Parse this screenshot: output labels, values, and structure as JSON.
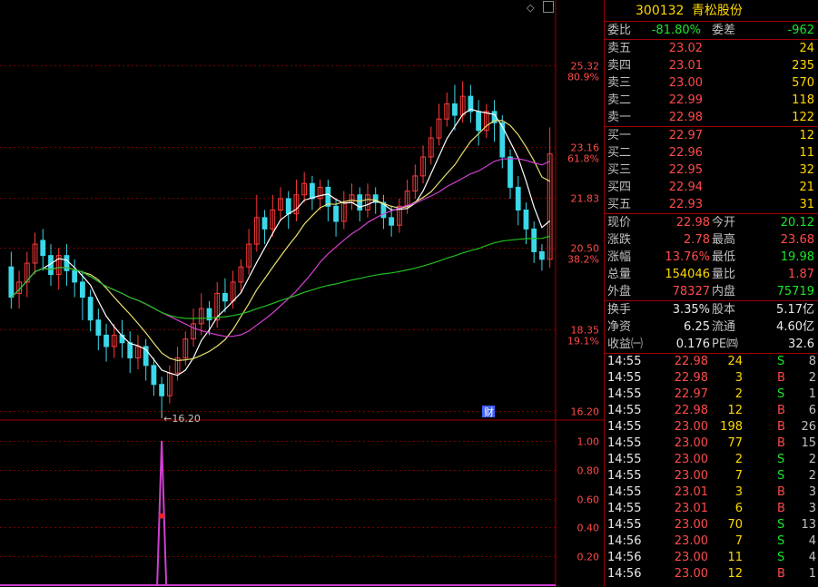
{
  "chart_data": {
    "type": "candlestick",
    "price_axis": {
      "ticks": [
        {
          "price": 25.32,
          "label": "25.32",
          "pct": "80.9%"
        },
        {
          "price": 23.16,
          "label": "23.16",
          "pct": "61.8%"
        },
        {
          "price": 21.83,
          "label": "21.83",
          "pct": ""
        },
        {
          "price": 20.5,
          "label": "20.50",
          "pct": "38.2%"
        },
        {
          "price": 18.35,
          "label": "18.35",
          "pct": "19.1%"
        },
        {
          "price": 16.2,
          "label": "16.20",
          "pct": ""
        }
      ],
      "range": [
        16.2,
        26.8
      ]
    },
    "low_marker": {
      "price": 16.2,
      "label": "16.20"
    },
    "finance_badge": "财",
    "candles": [
      [
        20.0,
        19.2,
        20.4,
        18.9
      ],
      [
        19.3,
        19.6,
        19.9,
        18.9
      ],
      [
        19.6,
        20.1,
        20.4,
        19.2
      ],
      [
        20.1,
        20.6,
        20.9,
        19.8
      ],
      [
        20.7,
        20.3,
        21.0,
        19.9
      ],
      [
        20.3,
        19.8,
        20.6,
        19.5
      ],
      [
        19.8,
        20.3,
        20.5,
        19.4
      ],
      [
        20.3,
        19.9,
        20.6,
        19.5
      ],
      [
        19.9,
        19.6,
        20.2,
        19.2
      ],
      [
        19.6,
        19.2,
        19.9,
        18.6
      ],
      [
        19.2,
        18.6,
        19.4,
        18.3
      ],
      [
        18.6,
        18.2,
        18.9,
        17.8
      ],
      [
        18.2,
        17.9,
        18.5,
        17.5
      ],
      [
        17.9,
        18.2,
        18.5,
        17.6
      ],
      [
        18.2,
        18.0,
        18.6,
        17.6
      ],
      [
        18.0,
        17.6,
        18.3,
        17.2
      ],
      [
        17.6,
        17.9,
        18.2,
        17.3
      ],
      [
        17.9,
        17.4,
        18.1,
        17.0
      ],
      [
        17.4,
        16.9,
        17.6,
        16.6
      ],
      [
        16.9,
        16.6,
        17.1,
        16.2
      ],
      [
        16.6,
        17.2,
        17.4,
        16.4
      ],
      [
        17.2,
        17.6,
        17.9,
        17.0
      ],
      [
        17.6,
        18.1,
        18.3,
        17.4
      ],
      [
        18.1,
        18.5,
        18.9,
        17.9
      ],
      [
        18.5,
        18.9,
        19.3,
        18.2
      ],
      [
        18.9,
        18.6,
        19.1,
        18.2
      ],
      [
        18.6,
        19.3,
        19.6,
        18.4
      ],
      [
        19.3,
        19.1,
        19.7,
        18.8
      ],
      [
        19.1,
        19.6,
        19.9,
        18.9
      ],
      [
        19.6,
        20.0,
        20.2,
        19.3
      ],
      [
        20.0,
        20.6,
        21.0,
        19.8
      ],
      [
        20.6,
        21.3,
        21.9,
        20.4
      ],
      [
        21.3,
        21.0,
        21.5,
        20.6
      ],
      [
        21.0,
        21.5,
        21.9,
        20.8
      ],
      [
        21.5,
        21.8,
        22.1,
        21.2
      ],
      [
        21.8,
        21.4,
        22.0,
        21.0
      ],
      [
        21.4,
        21.9,
        22.3,
        21.2
      ],
      [
        21.9,
        22.2,
        22.5,
        21.7
      ],
      [
        22.2,
        21.8,
        22.4,
        21.5
      ],
      [
        21.8,
        22.1,
        22.3,
        21.5
      ],
      [
        22.1,
        21.6,
        22.3,
        21.2
      ],
      [
        21.6,
        21.2,
        21.8,
        20.8
      ],
      [
        21.2,
        21.7,
        22.0,
        21.0
      ],
      [
        21.7,
        21.9,
        22.2,
        21.5
      ],
      [
        21.9,
        21.5,
        22.1,
        21.2
      ],
      [
        21.5,
        21.9,
        22.2,
        21.3
      ],
      [
        21.9,
        21.7,
        22.1,
        21.4
      ],
      [
        21.7,
        21.3,
        21.9,
        21.0
      ],
      [
        21.3,
        21.1,
        21.6,
        20.8
      ],
      [
        21.1,
        21.6,
        21.8,
        20.9
      ],
      [
        21.6,
        22.0,
        22.3,
        21.4
      ],
      [
        22.0,
        22.4,
        22.7,
        21.8
      ],
      [
        22.4,
        22.9,
        23.2,
        22.2
      ],
      [
        22.9,
        23.4,
        23.7,
        22.7
      ],
      [
        23.4,
        23.9,
        24.3,
        23.2
      ],
      [
        23.9,
        24.3,
        24.6,
        23.7
      ],
      [
        24.3,
        24.0,
        24.8,
        23.6
      ],
      [
        24.0,
        24.5,
        24.9,
        23.8
      ],
      [
        24.5,
        24.1,
        24.8,
        23.8
      ],
      [
        24.1,
        23.6,
        24.4,
        23.2
      ],
      [
        23.6,
        24.1,
        24.3,
        23.4
      ],
      [
        24.1,
        23.8,
        24.4,
        23.3
      ],
      [
        23.8,
        22.9,
        24.0,
        22.6
      ],
      [
        22.9,
        22.1,
        23.1,
        21.8
      ],
      [
        22.1,
        21.5,
        22.4,
        21.1
      ],
      [
        21.5,
        21.0,
        21.7,
        20.6
      ],
      [
        21.0,
        20.4,
        21.2,
        20.1
      ],
      [
        20.4,
        20.2,
        20.6,
        19.9
      ],
      [
        20.2,
        22.98,
        23.68,
        19.98
      ]
    ],
    "ma_series": [
      {
        "color": "#ffffff"
      },
      {
        "color": "#e8e070"
      },
      {
        "color": "#d040d0"
      },
      {
        "color": "#20c020"
      }
    ],
    "indicator": {
      "ticks": [
        "1.00",
        "0.80",
        "0.60",
        "0.40",
        "0.20"
      ],
      "range": [
        0,
        1.1
      ],
      "spike_index": 19,
      "spike_value": 1.0,
      "marker_value": 0.48
    }
  },
  "quote": {
    "code": "300132",
    "name": "青松股份",
    "weibi": {
      "label": "委比",
      "value": "-81.80%",
      "label2": "委差",
      "value2": "-962"
    },
    "asks": [
      {
        "label": "卖五",
        "price": "23.02",
        "vol": "24"
      },
      {
        "label": "卖四",
        "price": "23.01",
        "vol": "235"
      },
      {
        "label": "卖三",
        "price": "23.00",
        "vol": "570"
      },
      {
        "label": "卖二",
        "price": "22.99",
        "vol": "118"
      },
      {
        "label": "卖一",
        "price": "22.98",
        "vol": "122"
      }
    ],
    "bids": [
      {
        "label": "买一",
        "price": "22.97",
        "vol": "12"
      },
      {
        "label": "买二",
        "price": "22.96",
        "vol": "11"
      },
      {
        "label": "买三",
        "price": "22.95",
        "vol": "32"
      },
      {
        "label": "买四",
        "price": "22.94",
        "vol": "21"
      },
      {
        "label": "买五",
        "price": "22.93",
        "vol": "31"
      }
    ],
    "stats": [
      {
        "l1": "现价",
        "v1": "22.98",
        "c1": "red",
        "l2": "今开",
        "v2": "20.12",
        "c2": "green"
      },
      {
        "l1": "涨跌",
        "v1": "2.78",
        "c1": "red",
        "l2": "最高",
        "v2": "23.68",
        "c2": "red"
      },
      {
        "l1": "涨幅",
        "v1": "13.76%",
        "c1": "red",
        "l2": "最低",
        "v2": "19.98",
        "c2": "green"
      },
      {
        "l1": "总量",
        "v1": "154046",
        "c1": "yellow",
        "l2": "量比",
        "v2": "1.87",
        "c2": "red"
      },
      {
        "l1": "外盘",
        "v1": "78327",
        "c1": "red",
        "l2": "内盘",
        "v2": "75719",
        "c2": "green"
      }
    ],
    "stats2": [
      {
        "l1": "换手",
        "v1": "3.35%",
        "l2": "股本",
        "v2": "5.17亿"
      },
      {
        "l1": "净资",
        "v1": "6.25",
        "l2": "流通",
        "v2": "4.60亿"
      },
      {
        "l1": "收益㈠",
        "v1": "0.176",
        "l2": "PE㈣",
        "v2": "32.6"
      }
    ],
    "trades": [
      {
        "t": "14:55",
        "p": "22.98",
        "v": "24",
        "f": "S",
        "n": "8"
      },
      {
        "t": "14:55",
        "p": "22.98",
        "v": "3",
        "f": "B",
        "n": "2"
      },
      {
        "t": "14:55",
        "p": "22.97",
        "v": "2",
        "f": "S",
        "n": "1"
      },
      {
        "t": "14:55",
        "p": "22.98",
        "v": "12",
        "f": "B",
        "n": "6"
      },
      {
        "t": "14:55",
        "p": "23.00",
        "v": "198",
        "f": "B",
        "n": "26"
      },
      {
        "t": "14:55",
        "p": "23.00",
        "v": "77",
        "f": "B",
        "n": "15"
      },
      {
        "t": "14:55",
        "p": "23.00",
        "v": "2",
        "f": "S",
        "n": "2"
      },
      {
        "t": "14:55",
        "p": "23.00",
        "v": "7",
        "f": "S",
        "n": "2"
      },
      {
        "t": "14:55",
        "p": "23.01",
        "v": "3",
        "f": "B",
        "n": "3"
      },
      {
        "t": "14:55",
        "p": "23.01",
        "v": "6",
        "f": "B",
        "n": "3"
      },
      {
        "t": "14:55",
        "p": "23.00",
        "v": "70",
        "f": "S",
        "n": "13"
      },
      {
        "t": "14:56",
        "p": "23.00",
        "v": "7",
        "f": "S",
        "n": "4"
      },
      {
        "t": "14:56",
        "p": "23.00",
        "v": "11",
        "f": "S",
        "n": "4"
      },
      {
        "t": "14:56",
        "p": "23.00",
        "v": "12",
        "f": "B",
        "n": "1"
      }
    ],
    "prev_close": 20.2
  },
  "colors": {
    "up": "#ff3a3a",
    "down": "#3ad8e8",
    "grid": "#7a0000",
    "border": "#a00000",
    "axis_text": "#ff4a4a"
  }
}
